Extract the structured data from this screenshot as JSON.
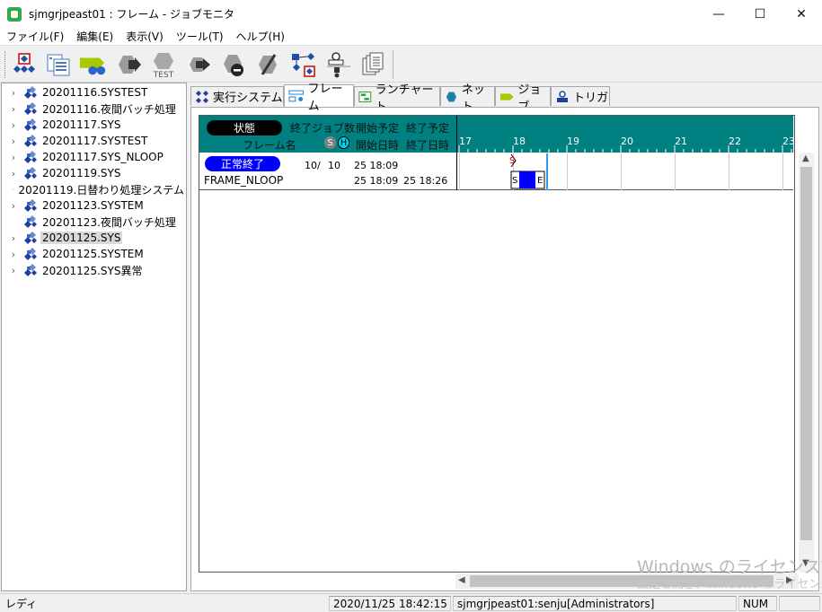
{
  "window": {
    "title": "sjmgrjpeast01 : フレーム - ジョブモニタ",
    "min_glyph": "—",
    "max_glyph": "☐",
    "close_glyph": "✕"
  },
  "menu": [
    "ファイル(F)",
    "編集(E)",
    "表示(V)",
    "ツール(T)",
    "ヘルプ(H)"
  ],
  "toolbar": {
    "buttons": [
      "system-monitor-icon",
      "list-view-icon",
      "binoculars-icon",
      "run-job-icon",
      "test-run-icon",
      "forward-icon",
      "stop-icon",
      "slash-icon",
      "network-icon",
      "job-detail-icon",
      "document-stack-icon"
    ],
    "test_label": "TEST"
  },
  "tree": {
    "items": [
      {
        "label": "20201116.SYSTEST",
        "expandable": true
      },
      {
        "label": "20201116.夜間バッチ処理",
        "expandable": true
      },
      {
        "label": "20201117.SYS",
        "expandable": true
      },
      {
        "label": "20201117.SYSTEST",
        "expandable": true
      },
      {
        "label": "20201117.SYS_NLOOP",
        "expandable": true
      },
      {
        "label": "20201119.SYS",
        "expandable": true
      },
      {
        "label": "20201119.日替わり処理システム",
        "expandable": false
      },
      {
        "label": "20201123.SYSTEM",
        "expandable": true
      },
      {
        "label": "20201123.夜間バッチ処理",
        "expandable": false
      },
      {
        "label": "20201125.SYS",
        "expandable": true,
        "selected": true
      },
      {
        "label": "20201125.SYSTEM",
        "expandable": true
      },
      {
        "label": "20201125.SYS異常",
        "expandable": true
      }
    ]
  },
  "tabs": [
    {
      "label": "実行システム",
      "icon": "system-icon"
    },
    {
      "label": "フレーム",
      "icon": "frame-icon",
      "active": true
    },
    {
      "label": "ランチャート",
      "icon": "runchart-icon"
    },
    {
      "label": "ネット",
      "icon": "net-icon"
    },
    {
      "label": "ジョブ",
      "icon": "job-icon"
    },
    {
      "label": "トリガ",
      "icon": "trigger-icon"
    }
  ],
  "grid": {
    "header": {
      "state": "状態",
      "frame_name": "フレーム名",
      "done_jobs": "終了ジョブ数",
      "planned_start": "開始予定",
      "planned_end": "終了予定",
      "start_time": "開始日時",
      "end_time": "終了日時",
      "s_badge": "S",
      "h_badge": "H"
    },
    "hours": [
      "17",
      "18",
      "19",
      "20",
      "21",
      "22",
      "23"
    ],
    "rows": [
      {
        "status": "正常終了",
        "frame": "FRAME_NLOOP",
        "done": "10/",
        "total": "10",
        "planned_start": "25 18:09",
        "start": "25 18:09",
        "end": "25 18:26",
        "gantt_plan_label": "S",
        "gantt_start_label": "S",
        "gantt_end_label": "E"
      }
    ]
  },
  "watermark": {
    "line1": "Windows のライセンス認証",
    "line2": "設定を開き、Windows のライセンス"
  },
  "status": {
    "mode": "レディ",
    "datetime": "2020/11/25 18:42:15",
    "user": "sjmgrjpeast01:senju[Administrators]",
    "num": "NUM"
  },
  "colors": {
    "header_teal": "#008080",
    "status_ok": "#0000ff",
    "current_time_line": "#3399ff"
  }
}
